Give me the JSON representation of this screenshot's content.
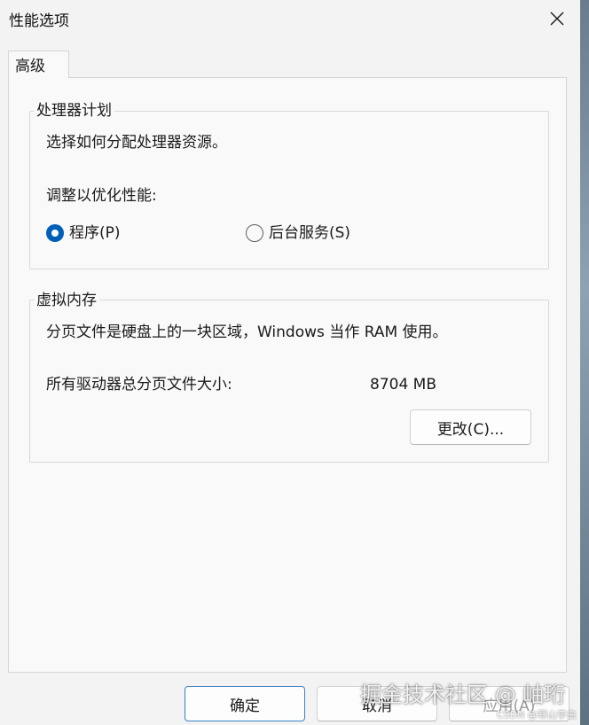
{
  "window": {
    "title": "性能选项",
    "close_icon": "close-icon"
  },
  "tabs": [
    {
      "label": "高级",
      "selected": true
    }
  ],
  "processor_group": {
    "legend": "处理器计划",
    "description": "选择如何分配处理器资源。",
    "adjust_label": "调整以优化性能:",
    "options": [
      {
        "label": "程序(P)",
        "checked": true
      },
      {
        "label": "后台服务(S)",
        "checked": false
      }
    ]
  },
  "virtual_memory_group": {
    "legend": "虚拟内存",
    "description": "分页文件是硬盘上的一块区域，Windows 当作 RAM 使用。",
    "total_label": "所有驱动器总分页文件大小:",
    "total_value": "8704 MB",
    "change_button": "更改(C)..."
  },
  "footer": {
    "ok_button": "确定",
    "cancel_button": "取消",
    "apply_button": "应用(A)"
  },
  "watermark": {
    "main": "掘金技术社区 @ 岫珩",
    "small": "CSDN @寒山李白"
  },
  "colors": {
    "accent": "#005fb8",
    "window_bg": "#f3f3f3",
    "panel_bg": "#f9f9f9"
  }
}
